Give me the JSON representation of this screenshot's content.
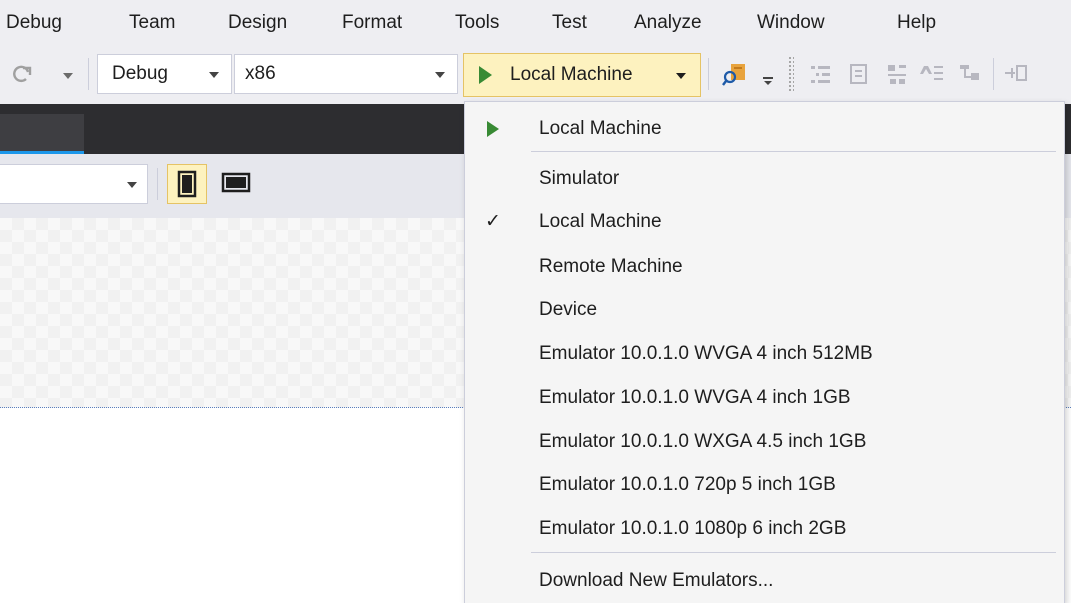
{
  "menubar": {
    "items": [
      "Debug",
      "Team",
      "Design",
      "Format",
      "Tools",
      "Test",
      "Analyze",
      "Window",
      "Help"
    ]
  },
  "toolbar": {
    "redo_icon": "redo-icon",
    "configuration": "Debug",
    "platform": "x86",
    "run_target": "Local Machine",
    "icons": [
      "find-in-files-icon",
      "toolbar-overflow-icon",
      "outline-icon",
      "document-icon",
      "align-icon",
      "sort-icon",
      "tree-icon",
      "more-icon"
    ]
  },
  "dropdown": {
    "items": [
      {
        "label": "Local Machine",
        "marker": "play",
        "separator_after": true
      },
      {
        "label": "Simulator",
        "marker": "none",
        "separator_after": false
      },
      {
        "label": "Local Machine",
        "marker": "check",
        "separator_after": false
      },
      {
        "label": "Remote Machine",
        "marker": "none",
        "separator_after": false
      },
      {
        "label": "Device",
        "marker": "none",
        "separator_after": false
      },
      {
        "label": "Emulator 10.0.1.0 WVGA 4 inch 512MB",
        "marker": "none",
        "separator_after": false
      },
      {
        "label": "Emulator 10.0.1.0 WVGA 4 inch 1GB",
        "marker": "none",
        "separator_after": false
      },
      {
        "label": "Emulator 10.0.1.0 WXGA 4.5 inch 1GB",
        "marker": "none",
        "separator_after": false
      },
      {
        "label": "Emulator 10.0.1.0 720p 5 inch 1GB",
        "marker": "none",
        "separator_after": false
      },
      {
        "label": "Emulator 10.0.1.0 1080p 6 inch 2GB",
        "marker": "none",
        "separator_after": true
      },
      {
        "label": "Download New Emulators...",
        "marker": "none",
        "separator_after": false
      }
    ],
    "check_glyph": "✓"
  },
  "designer": {
    "view_buttons": [
      "portrait-view-icon",
      "landscape-view-icon"
    ]
  },
  "colors": {
    "chrome": "#eeeef2",
    "dark_tabstrip": "#2d2d30",
    "highlight": "#fdf2bf",
    "run_green": "#388a34"
  }
}
